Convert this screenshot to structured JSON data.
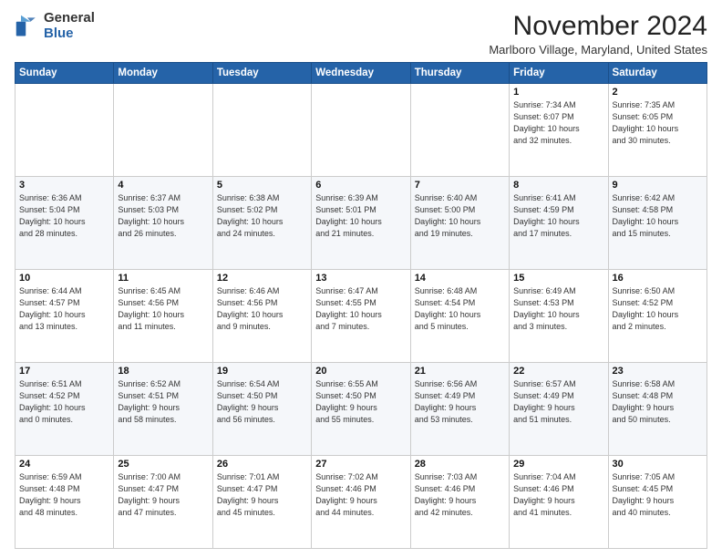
{
  "logo": {
    "general": "General",
    "blue": "Blue"
  },
  "header": {
    "month": "November 2024",
    "location": "Marlboro Village, Maryland, United States"
  },
  "weekdays": [
    "Sunday",
    "Monday",
    "Tuesday",
    "Wednesday",
    "Thursday",
    "Friday",
    "Saturday"
  ],
  "weeks": [
    [
      {
        "day": "",
        "info": ""
      },
      {
        "day": "",
        "info": ""
      },
      {
        "day": "",
        "info": ""
      },
      {
        "day": "",
        "info": ""
      },
      {
        "day": "",
        "info": ""
      },
      {
        "day": "1",
        "info": "Sunrise: 7:34 AM\nSunset: 6:07 PM\nDaylight: 10 hours\nand 32 minutes."
      },
      {
        "day": "2",
        "info": "Sunrise: 7:35 AM\nSunset: 6:05 PM\nDaylight: 10 hours\nand 30 minutes."
      }
    ],
    [
      {
        "day": "3",
        "info": "Sunrise: 6:36 AM\nSunset: 5:04 PM\nDaylight: 10 hours\nand 28 minutes."
      },
      {
        "day": "4",
        "info": "Sunrise: 6:37 AM\nSunset: 5:03 PM\nDaylight: 10 hours\nand 26 minutes."
      },
      {
        "day": "5",
        "info": "Sunrise: 6:38 AM\nSunset: 5:02 PM\nDaylight: 10 hours\nand 24 minutes."
      },
      {
        "day": "6",
        "info": "Sunrise: 6:39 AM\nSunset: 5:01 PM\nDaylight: 10 hours\nand 21 minutes."
      },
      {
        "day": "7",
        "info": "Sunrise: 6:40 AM\nSunset: 5:00 PM\nDaylight: 10 hours\nand 19 minutes."
      },
      {
        "day": "8",
        "info": "Sunrise: 6:41 AM\nSunset: 4:59 PM\nDaylight: 10 hours\nand 17 minutes."
      },
      {
        "day": "9",
        "info": "Sunrise: 6:42 AM\nSunset: 4:58 PM\nDaylight: 10 hours\nand 15 minutes."
      }
    ],
    [
      {
        "day": "10",
        "info": "Sunrise: 6:44 AM\nSunset: 4:57 PM\nDaylight: 10 hours\nand 13 minutes."
      },
      {
        "day": "11",
        "info": "Sunrise: 6:45 AM\nSunset: 4:56 PM\nDaylight: 10 hours\nand 11 minutes."
      },
      {
        "day": "12",
        "info": "Sunrise: 6:46 AM\nSunset: 4:56 PM\nDaylight: 10 hours\nand 9 minutes."
      },
      {
        "day": "13",
        "info": "Sunrise: 6:47 AM\nSunset: 4:55 PM\nDaylight: 10 hours\nand 7 minutes."
      },
      {
        "day": "14",
        "info": "Sunrise: 6:48 AM\nSunset: 4:54 PM\nDaylight: 10 hours\nand 5 minutes."
      },
      {
        "day": "15",
        "info": "Sunrise: 6:49 AM\nSunset: 4:53 PM\nDaylight: 10 hours\nand 3 minutes."
      },
      {
        "day": "16",
        "info": "Sunrise: 6:50 AM\nSunset: 4:52 PM\nDaylight: 10 hours\nand 2 minutes."
      }
    ],
    [
      {
        "day": "17",
        "info": "Sunrise: 6:51 AM\nSunset: 4:52 PM\nDaylight: 10 hours\nand 0 minutes."
      },
      {
        "day": "18",
        "info": "Sunrise: 6:52 AM\nSunset: 4:51 PM\nDaylight: 9 hours\nand 58 minutes."
      },
      {
        "day": "19",
        "info": "Sunrise: 6:54 AM\nSunset: 4:50 PM\nDaylight: 9 hours\nand 56 minutes."
      },
      {
        "day": "20",
        "info": "Sunrise: 6:55 AM\nSunset: 4:50 PM\nDaylight: 9 hours\nand 55 minutes."
      },
      {
        "day": "21",
        "info": "Sunrise: 6:56 AM\nSunset: 4:49 PM\nDaylight: 9 hours\nand 53 minutes."
      },
      {
        "day": "22",
        "info": "Sunrise: 6:57 AM\nSunset: 4:49 PM\nDaylight: 9 hours\nand 51 minutes."
      },
      {
        "day": "23",
        "info": "Sunrise: 6:58 AM\nSunset: 4:48 PM\nDaylight: 9 hours\nand 50 minutes."
      }
    ],
    [
      {
        "day": "24",
        "info": "Sunrise: 6:59 AM\nSunset: 4:48 PM\nDaylight: 9 hours\nand 48 minutes."
      },
      {
        "day": "25",
        "info": "Sunrise: 7:00 AM\nSunset: 4:47 PM\nDaylight: 9 hours\nand 47 minutes."
      },
      {
        "day": "26",
        "info": "Sunrise: 7:01 AM\nSunset: 4:47 PM\nDaylight: 9 hours\nand 45 minutes."
      },
      {
        "day": "27",
        "info": "Sunrise: 7:02 AM\nSunset: 4:46 PM\nDaylight: 9 hours\nand 44 minutes."
      },
      {
        "day": "28",
        "info": "Sunrise: 7:03 AM\nSunset: 4:46 PM\nDaylight: 9 hours\nand 42 minutes."
      },
      {
        "day": "29",
        "info": "Sunrise: 7:04 AM\nSunset: 4:46 PM\nDaylight: 9 hours\nand 41 minutes."
      },
      {
        "day": "30",
        "info": "Sunrise: 7:05 AM\nSunset: 4:45 PM\nDaylight: 9 hours\nand 40 minutes."
      }
    ]
  ]
}
